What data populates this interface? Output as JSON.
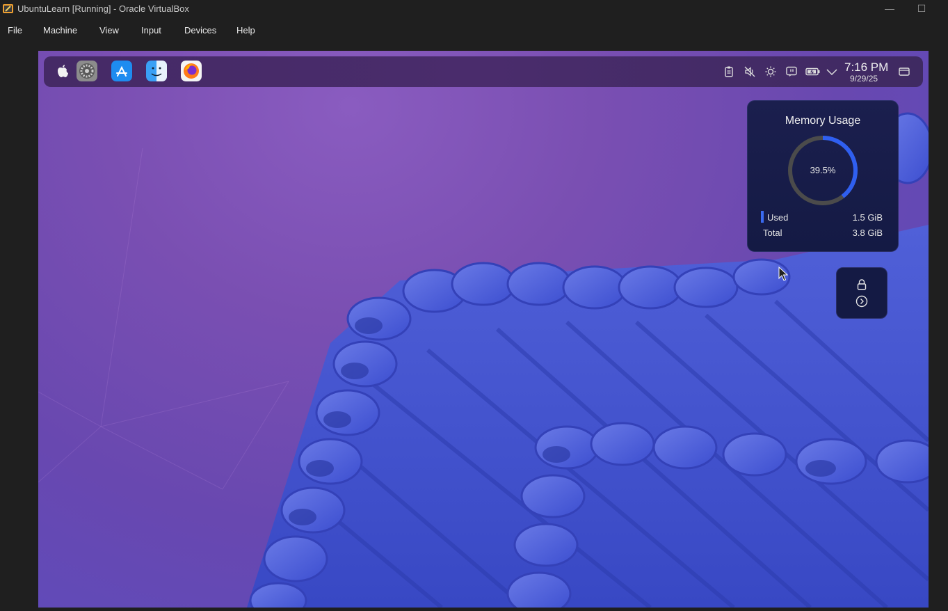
{
  "window": {
    "title": "UbuntuLearn [Running] - Oracle VirtualBox",
    "minimize_glyph": "—",
    "maximize_glyph": "☐"
  },
  "menu": [
    "File",
    "Machine",
    "View",
    "Input",
    "Devices",
    "Help"
  ],
  "panel": {
    "dock_icons": [
      "apple-icon",
      "system-settings-icon",
      "app-store-icon",
      "finder-icon",
      "firefox-icon"
    ],
    "tray_icons": [
      "clipboard-icon",
      "volume-muted-icon",
      "brightness-icon",
      "chat-icon",
      "battery-icon",
      "chevron-down-icon",
      "desktop-icon"
    ],
    "clock_time": "7:16 PM",
    "clock_date": "9/29/25"
  },
  "memory_widget": {
    "title": "Memory Usage",
    "percent_label": "39.5%",
    "percent_value": 0.395,
    "used_label": "Used",
    "used_value": "1.5 GiB",
    "total_label": "Total",
    "total_value": "3.8 GiB"
  },
  "lock_widget": {
    "icons": [
      "lock-icon",
      "arrow-right-circle-icon"
    ]
  },
  "colors": {
    "accent": "#3a6af0",
    "widget_bg": "#141a44"
  }
}
